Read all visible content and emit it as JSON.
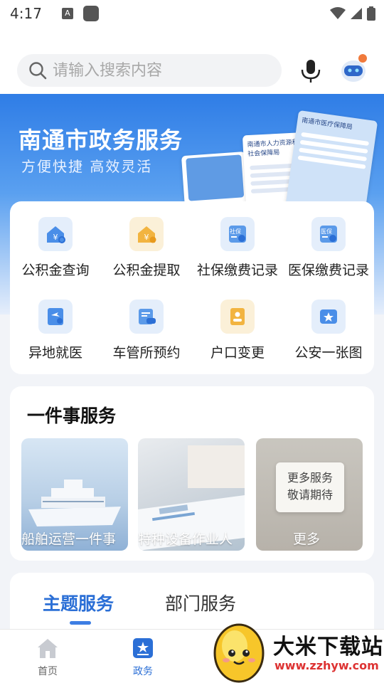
{
  "status": {
    "time": "4:17",
    "notif_icon": "A"
  },
  "search": {
    "placeholder": "请输入搜索内容"
  },
  "banner": {
    "title": "南通市政务服务",
    "subtitle": "方便快捷 高效灵活",
    "doc_titles": [
      "南通市医疗保障局",
      "南通市人力资源和社会保障局"
    ]
  },
  "services": [
    {
      "label": "公积金查询",
      "icon": "house-search-icon"
    },
    {
      "label": "公积金提取",
      "icon": "house-money-icon"
    },
    {
      "label": "社保缴费记录",
      "icon": "social-security-icon"
    },
    {
      "label": "医保缴费记录",
      "icon": "medical-insurance-icon"
    },
    {
      "label": "异地就医",
      "icon": "flight-doctor-icon"
    },
    {
      "label": "车管所预约",
      "icon": "car-appointment-icon"
    },
    {
      "label": "户口变更",
      "icon": "household-book-icon"
    },
    {
      "label": "公安一张图",
      "icon": "police-star-icon"
    }
  ],
  "onething": {
    "title": "一件事服务",
    "tiles": [
      {
        "label": "船舶运营一件事"
      },
      {
        "label": "特种设备作业人"
      },
      {
        "label": "更多",
        "note": [
          "更多服务",
          "敬请期待"
        ]
      }
    ]
  },
  "tabs": {
    "active": "主题服务",
    "second": "部门服务"
  },
  "nav": [
    {
      "label": "首页",
      "icon": "home-icon"
    },
    {
      "label": "政务",
      "icon": "government-star-icon"
    }
  ],
  "watermark": {
    "title": "大米下载站",
    "url": "www.zzhyw.com"
  },
  "colors": {
    "primary": "#2b6fd6",
    "banner_top": "#2f7de6",
    "background": "#f2f4f8"
  }
}
